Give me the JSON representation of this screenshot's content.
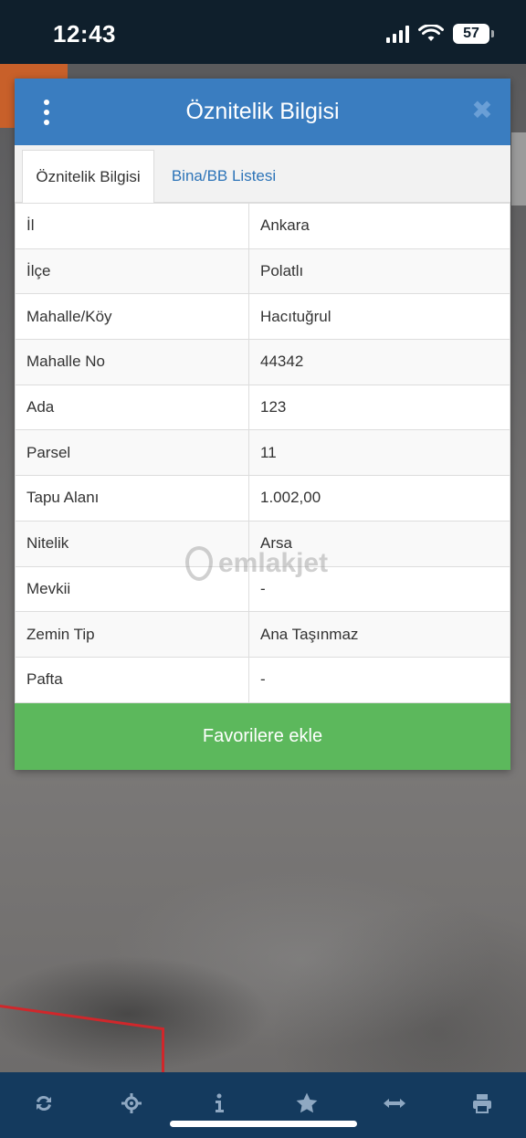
{
  "status_bar": {
    "time": "12:43",
    "battery": "57"
  },
  "modal": {
    "title": "Öznitelik Bilgisi",
    "tabs": [
      {
        "label": "Öznitelik Bilgisi",
        "active": true
      },
      {
        "label": "Bina/BB Listesi",
        "active": false
      }
    ],
    "rows": [
      {
        "key": "İl",
        "value": "Ankara"
      },
      {
        "key": "İlçe",
        "value": "Polatlı"
      },
      {
        "key": "Mahalle/Köy",
        "value": "Hacıtuğrul"
      },
      {
        "key": "Mahalle No",
        "value": "44342"
      },
      {
        "key": "Ada",
        "value": "123"
      },
      {
        "key": "Parsel",
        "value": "11"
      },
      {
        "key": "Tapu Alanı",
        "value": "1.002,00"
      },
      {
        "key": "Nitelik",
        "value": "Arsa"
      },
      {
        "key": "Mevkii",
        "value": "-"
      },
      {
        "key": "Zemin Tip",
        "value": "Ana Taşınmaz"
      },
      {
        "key": "Pafta",
        "value": "-"
      }
    ],
    "favorite_button": "Favorilere ekle"
  },
  "watermark": "emlakjet",
  "toolbar": {
    "icons": [
      "refresh-icon",
      "locate-icon",
      "info-icon",
      "star-icon",
      "measure-icon",
      "print-icon"
    ]
  },
  "colors": {
    "header": "#3a7dc0",
    "button": "#5cb85c",
    "toolbar": "#143a5e",
    "status_bar": "#0f1f2c"
  }
}
